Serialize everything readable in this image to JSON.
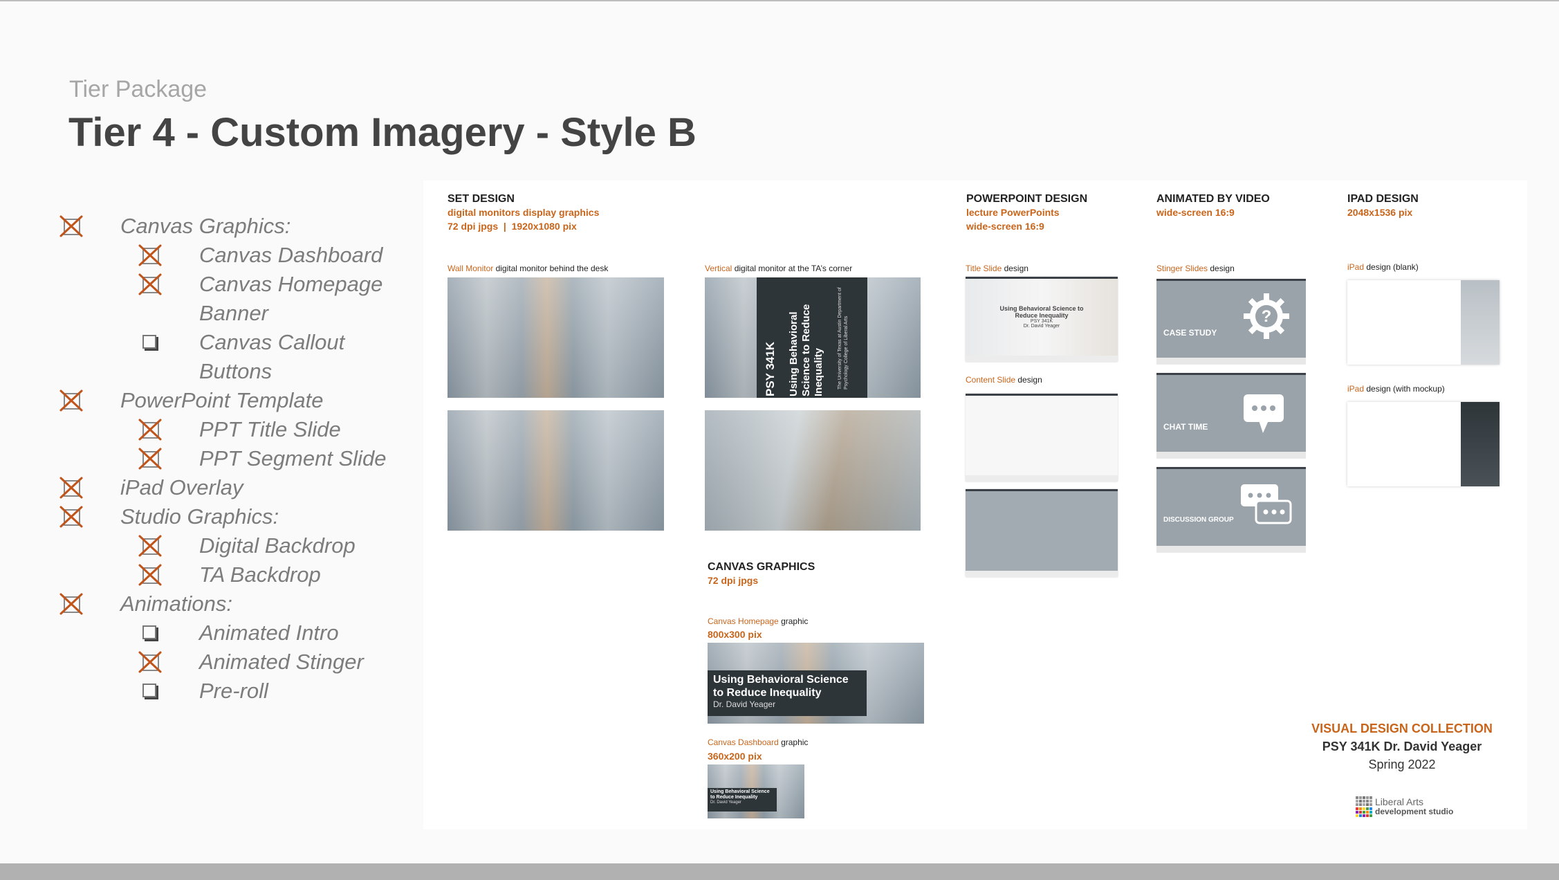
{
  "header": {
    "eyebrow": "Tier Package",
    "title": "Tier 4 - Custom Imagery - Style B"
  },
  "checklist": [
    {
      "label": "Canvas Graphics:",
      "level": 1,
      "checked": true
    },
    {
      "label": "Canvas Dashboard",
      "level": 2,
      "checked": true
    },
    {
      "label": "Canvas Homepage",
      "level": 2,
      "checked": true
    },
    {
      "label": "Banner",
      "level": 2,
      "continuation": true
    },
    {
      "label": "Canvas Callout",
      "level": 2,
      "checked": false
    },
    {
      "label": "Buttons",
      "level": 2,
      "continuation": true
    },
    {
      "label": "PowerPoint Template",
      "level": 1,
      "checked": true
    },
    {
      "label": "PPT Title Slide",
      "level": 2,
      "checked": true
    },
    {
      "label": "PPT Segment Slide",
      "level": 2,
      "checked": true
    },
    {
      "label": "iPad Overlay",
      "level": 1,
      "checked": true
    },
    {
      "label": "Studio Graphics:",
      "level": 1,
      "checked": true
    },
    {
      "label": "Digital Backdrop",
      "level": 2,
      "checked": true
    },
    {
      "label": "TA Backdrop",
      "level": 2,
      "checked": true
    },
    {
      "label": "Animations:",
      "level": 1,
      "checked": true
    },
    {
      "label": "Animated Intro",
      "level": 2,
      "checked": false
    },
    {
      "label": "Animated Stinger",
      "level": 2,
      "checked": true
    },
    {
      "label": "Pre-roll",
      "level": 2,
      "checked": false
    }
  ],
  "panel": {
    "set_design": {
      "heading": "SET DESIGN",
      "sub1": "digital monitors display graphics",
      "sub2": "72 dpi jpgs  |  1920x1080 pix",
      "wall_accent": "Wall Monitor",
      "wall_rest": " digital monitor behind the desk",
      "vertical_accent": "Vertical",
      "vertical_rest": " digital monitor at the TA’s corner",
      "vertical_card_title": "PSY 341K",
      "vertical_card_sub": "Using Behavioral Science to Reduce Inequality",
      "vertical_card_dept": "The University of Texas at Austin Department of Psychology College of Liberal Arts"
    },
    "powerpoint": {
      "heading": "POWERPOINT DESIGN",
      "sub1": "lecture PowerPoints",
      "sub2": "wide-screen 16:9",
      "title_accent": "Title Slide",
      "title_rest": " design",
      "content_accent": "Content Slide",
      "content_rest": " design",
      "slide_title": "Using Behavioral Science to Reduce Inequality",
      "slide_course": "PSY 341K",
      "slide_author": "Dr. David Yeager"
    },
    "animated": {
      "heading": "ANIMATED BY VIDEO",
      "sub1": "wide-screen 16:9",
      "stinger_accent": "Stinger Slides",
      "stinger_rest": " design",
      "case_study": "CASE STUDY",
      "chat_time": "CHAT TIME",
      "discussion": "DISCUSSION GROUP"
    },
    "ipad": {
      "heading": "IPAD DESIGN",
      "sub1": "2048x1536 pix",
      "blank_accent": "iPad",
      "blank_rest": " design (blank)",
      "mockup_accent": "iPad",
      "mockup_rest": " design (with mockup)"
    },
    "canvas": {
      "heading": "CANVAS GRAPHICS",
      "sub1": "72 dpi jpgs",
      "home_accent": "Canvas Homepage",
      "home_rest": " graphic",
      "home_size": "800x300 pix",
      "home_title": "Using Behavioral Science to Reduce Inequality",
      "home_author": "Dr. David Yeager",
      "dash_accent": "Canvas Dashboard",
      "dash_rest": " graphic",
      "dash_size": "360x200 pix",
      "dash_title": "Using Behavioral Science to Reduce Inequality",
      "dash_author": "Dr. David Yeager"
    },
    "collection": {
      "line1": "VISUAL DESIGN COLLECTION",
      "line2": "PSY 341K Dr. David Yeager",
      "line3": "Spring 2022",
      "logo_line1": "Liberal Arts",
      "logo_line2": "development studio"
    }
  },
  "colors": {
    "accent": "#c8651b",
    "check_x": "#c0541a",
    "dark_card": "#2e3539"
  }
}
